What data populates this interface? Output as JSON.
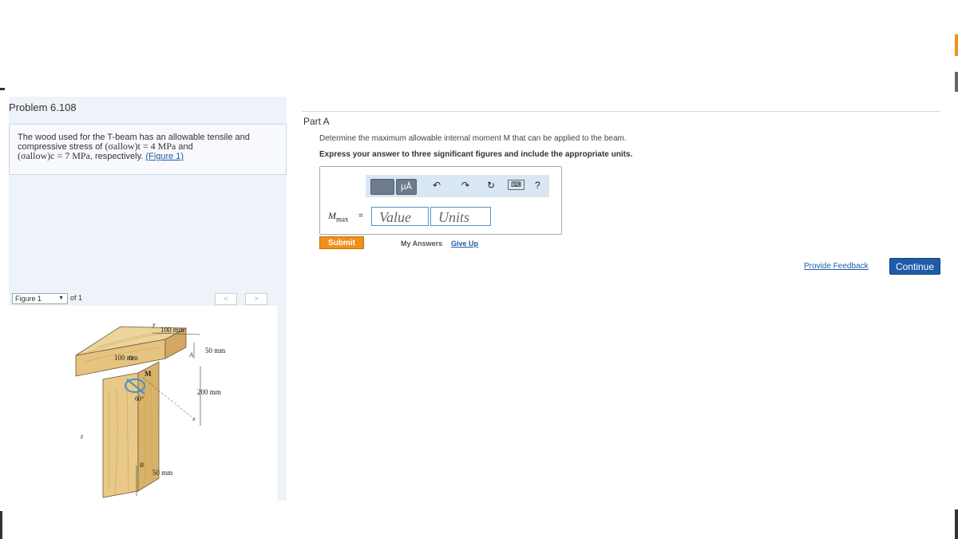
{
  "problem": {
    "title": "Problem 6.108",
    "text_intro": "The wood used for the T-beam has an allowable tensile and compressive stress of",
    "sigma_t": "(σallow)t = 4 MPa",
    "text_and": "and",
    "sigma_c": "(σallow)c = 7 MPa",
    "text_resp": ", respectively.",
    "figure_link": "(Figure 1)"
  },
  "figure_nav": {
    "selected": "Figure 1",
    "of_text": "of 1",
    "prev_glyph": "<",
    "next_glyph": ">"
  },
  "figure": {
    "dim_top": "100 mm",
    "dim_left": "100 mm",
    "dim_flange": "50 mm",
    "dim_web_height": "200 mm",
    "dim_web_width": "50 mm",
    "label_m": "M",
    "label_angle": "60°",
    "label_a": "A",
    "label_b": "B",
    "label_x": "x",
    "label_y": "y",
    "label_z": "z",
    "label_o": "O"
  },
  "part": {
    "label": "Part A",
    "question": "Determine the maximum allowable internal moment M that can be applied to the beam.",
    "instruction": "Express your answer to three significant figures and include the appropriate units."
  },
  "answer": {
    "var_main": "M",
    "var_sub": "max",
    "equals": "=",
    "value_placeholder": "Value",
    "units_placeholder": "Units",
    "toolbar_mu": "μÅ",
    "toolbar_help": "?"
  },
  "actions": {
    "submit": "Submit",
    "my_answers": "My Answers",
    "give_up": "Give Up",
    "feedback": "Provide Feedback",
    "continue": "Continue"
  },
  "colors": {
    "submit": "#f0901a",
    "continue": "#1e5ba8",
    "link": "#1e5ba8",
    "panel": "#eef3f9"
  }
}
